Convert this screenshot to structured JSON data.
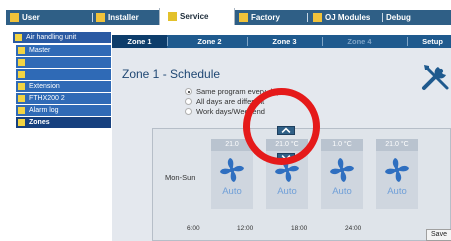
{
  "top_tabs": [
    {
      "label": "User",
      "active": false
    },
    {
      "label": "Installer",
      "active": false
    },
    {
      "label": "Service",
      "active": true
    },
    {
      "label": "Factory",
      "active": false
    },
    {
      "label": "OJ Modules",
      "active": false
    },
    {
      "label": "Debug",
      "active": false
    }
  ],
  "sidebar": {
    "items": [
      {
        "label": "Air handling unit",
        "icon": "unit-icon"
      },
      {
        "label": "Master",
        "icon": "unit-icon"
      },
      {
        "label": "",
        "icon": "unit-icon"
      },
      {
        "label": "",
        "icon": "unit-icon"
      },
      {
        "label": "Extension",
        "icon": "unit-icon"
      },
      {
        "label": "FTHX200 2",
        "icon": "unit-icon"
      },
      {
        "label": "Alarm log",
        "icon": "unit-icon"
      },
      {
        "label": "Zones",
        "icon": "unit-icon",
        "active": true
      }
    ]
  },
  "sub_tabs": [
    {
      "label": "Zone 1",
      "active": true
    },
    {
      "label": "Zone 2"
    },
    {
      "label": "Zone 3"
    },
    {
      "label": "Zone 4",
      "disabled": true
    },
    {
      "label": "Setup"
    }
  ],
  "page_title": "Zone 1 - Schedule",
  "radio_options": [
    {
      "label": "Same program every day",
      "checked": true
    },
    {
      "label": "All days are different",
      "checked": false
    },
    {
      "label": "Work days/Weekend",
      "checked": false
    }
  ],
  "schedule": {
    "row_label": "Mon-Sun",
    "blocks": [
      {
        "temp": "21.0",
        "mode": "Auto"
      },
      {
        "temp": "21.0 °C",
        "mode": "Auto"
      },
      {
        "temp": "1.0 °C",
        "mode": "Auto"
      },
      {
        "temp": "21.0 °C",
        "mode": "Auto"
      }
    ],
    "times": [
      "6:00",
      "12:00",
      "18:00",
      "24:00"
    ]
  },
  "save_label": "Save",
  "colors": {
    "accent_blue": "#2f5f86",
    "fan_blue": "#2f6fc0",
    "highlight_red": "#e51a1a"
  }
}
